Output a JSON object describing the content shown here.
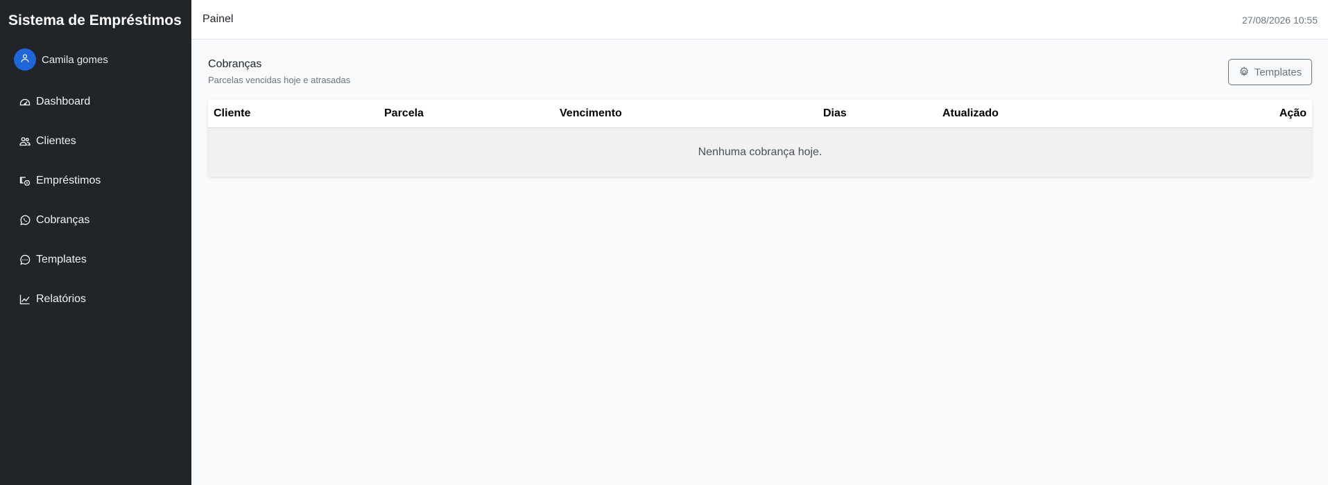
{
  "sidebar": {
    "brand": "Sistema de Empréstimos",
    "user": {
      "name": "Camila gomes",
      "avatar_color": "#1f66d9"
    },
    "items": [
      {
        "label": "Dashboard",
        "icon": "speedometer-icon"
      },
      {
        "label": "Clientes",
        "icon": "people-icon"
      },
      {
        "label": "Empréstimos",
        "icon": "cash-coin-icon"
      },
      {
        "label": "Cobranças",
        "icon": "whatsapp-icon"
      },
      {
        "label": "Templates",
        "icon": "chat-dots-icon"
      },
      {
        "label": "Relatórios",
        "icon": "graph-up-icon"
      }
    ],
    "background": "#212529"
  },
  "header": {
    "title": "Painel",
    "datetime": "27/08/2026 10:55"
  },
  "main": {
    "title": "Cobranças",
    "subtitle": "Parcelas vencidas hoje e atrasadas",
    "templates_button": {
      "label": "Templates",
      "icon": "gear-icon"
    },
    "table": {
      "columns": [
        "Cliente",
        "Parcela",
        "Vencimento",
        "Dias",
        "Atualizado",
        "Ação"
      ],
      "empty_message": "Nenhuma cobrança hoje."
    }
  }
}
